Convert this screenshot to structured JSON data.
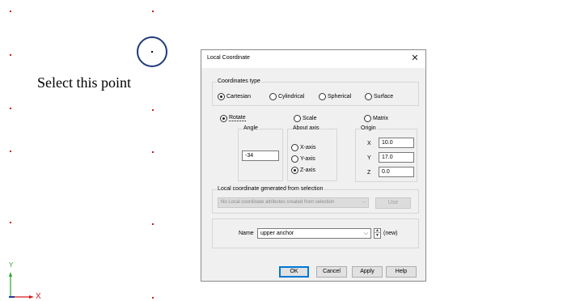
{
  "canvas": {
    "hint_text": "Select this point",
    "axis_y_label": "Y",
    "axis_x_label": "X",
    "point_color": "#d11a1a",
    "circle_color": "#1f3a7a"
  },
  "dialog": {
    "title": "Local Coordinate",
    "close_icon": "close-icon",
    "coordinates_type": {
      "label": "Coordinates type",
      "options": [
        "Cartesian",
        "Cylindrical",
        "Spherical",
        "Surface"
      ],
      "selected": "Cartesian"
    },
    "mode": {
      "options": [
        "Rotate",
        "Scale",
        "Matrix"
      ],
      "selected": "Rotate"
    },
    "angle": {
      "label": "Angle",
      "value": "-34"
    },
    "about_axis": {
      "label": "About axis",
      "options": [
        "X-axis",
        "Y-axis",
        "Z-axis"
      ],
      "selected": "Z-axis"
    },
    "origin": {
      "label": "Origin",
      "x_label": "X",
      "x_value": "10.0",
      "y_label": "Y",
      "y_value": "17.0",
      "z_label": "Z",
      "z_value": "0.0"
    },
    "selection": {
      "label": "Local coordinate generated from selection",
      "combo_value": "No Local coordinate attributes created from selection",
      "use_label": "Use"
    },
    "name": {
      "label": "Name",
      "value": "upper anchor",
      "status": "(new)"
    },
    "buttons": {
      "ok": "OK",
      "cancel": "Cancel",
      "apply": "Apply",
      "help": "Help"
    }
  }
}
